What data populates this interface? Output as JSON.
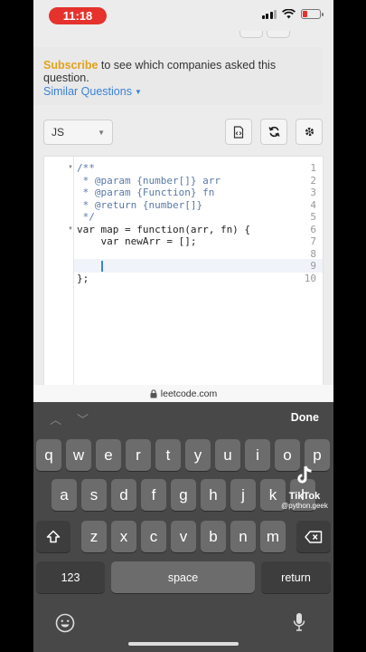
{
  "status_bar": {
    "time": "11:18"
  },
  "info_panel": {
    "subscribe_link": "Subscribe",
    "subscribe_rest": " to see which companies asked this question.",
    "similar_questions": "Similar Questions"
  },
  "toolbar": {
    "language": "JS"
  },
  "editor": {
    "lines": [
      {
        "n": "1",
        "text": "/**"
      },
      {
        "n": "2",
        "text": " * @param {number[]} arr"
      },
      {
        "n": "3",
        "text": " * @param {Function} fn"
      },
      {
        "n": "4",
        "text": " * @return {number[]}"
      },
      {
        "n": "5",
        "text": " */"
      },
      {
        "n": "6",
        "text": "var map = function(arr, fn) {"
      },
      {
        "n": "7",
        "text": "    var newArr = [];"
      },
      {
        "n": "8",
        "text": ""
      },
      {
        "n": "9",
        "text": ""
      },
      {
        "n": "10",
        "text": "};"
      }
    ]
  },
  "url_bar": {
    "domain": "leetcode.com"
  },
  "keyboard": {
    "done": "Done",
    "row1": [
      "q",
      "w",
      "e",
      "r",
      "t",
      "y",
      "u",
      "i",
      "o",
      "p"
    ],
    "row2": [
      "a",
      "s",
      "d",
      "f",
      "g",
      "h",
      "j",
      "k",
      "l"
    ],
    "row3": [
      "z",
      "x",
      "c",
      "v",
      "b",
      "n",
      "m"
    ],
    "numbers_key": "123",
    "space_key": "space",
    "return_key": "return"
  },
  "watermark": {
    "name": "TikTok",
    "user": "@python.geek"
  },
  "colors": {
    "accent_link": "#3b82d6",
    "subscribe": "#e2a21a",
    "time_pill": "#e5322c"
  }
}
